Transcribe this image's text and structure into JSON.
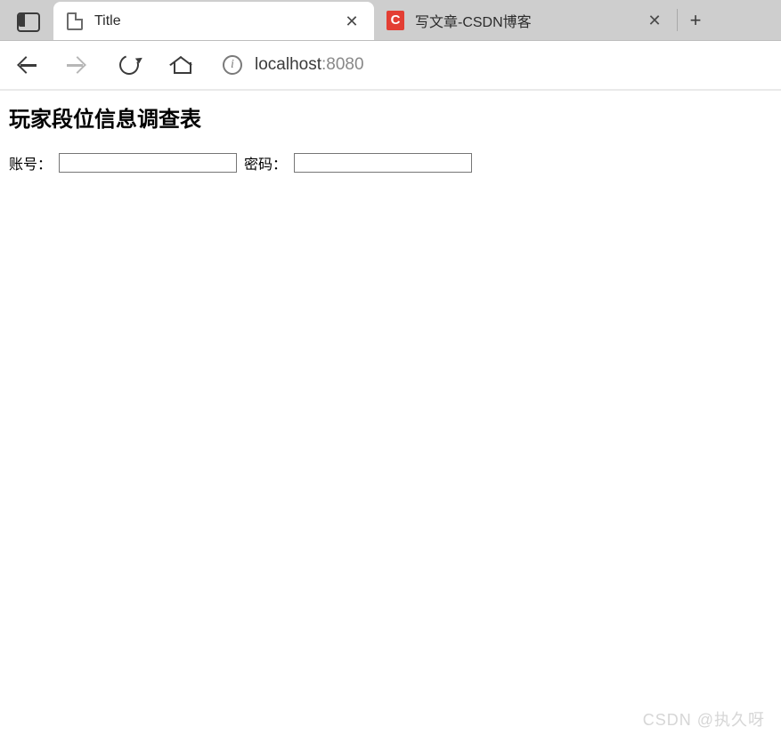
{
  "browser": {
    "tabs": [
      {
        "title": "Title",
        "active": true
      },
      {
        "title": "写文章-CSDN博客",
        "active": false,
        "favicon_letter": "C"
      }
    ],
    "address": {
      "host": "localhost",
      "port": ":8080"
    }
  },
  "page": {
    "heading": "玩家段位信息调查表",
    "form": {
      "account_label": "账号：",
      "account_value": "",
      "password_label": "密码：",
      "password_value": ""
    }
  },
  "watermark": "CSDN @执久呀"
}
